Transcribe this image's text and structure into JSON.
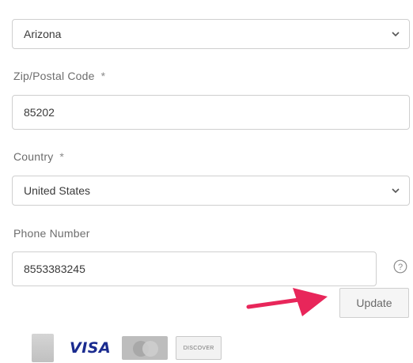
{
  "form": {
    "state": {
      "value": "Arizona"
    },
    "zip": {
      "label": "Zip/Postal Code",
      "required_mark": "*",
      "value": "85202"
    },
    "country": {
      "label": "Country",
      "required_mark": "*",
      "value": "United States"
    },
    "phone": {
      "label": "Phone Number",
      "value": "8553383245"
    }
  },
  "actions": {
    "update_label": "Update"
  },
  "icons": {
    "select_chevron": "chevron-down-icon",
    "help": "question-circle-icon",
    "pointer": "red-arrow-icon"
  },
  "payment_cards": {
    "visa_label": "VISA",
    "discover_label": "DISCOVER"
  },
  "colors": {
    "arrow": "#e8265a",
    "visa_text": "#1a2b8f",
    "field_border": "#cfcfcf",
    "label_text": "#6d6d6d"
  }
}
